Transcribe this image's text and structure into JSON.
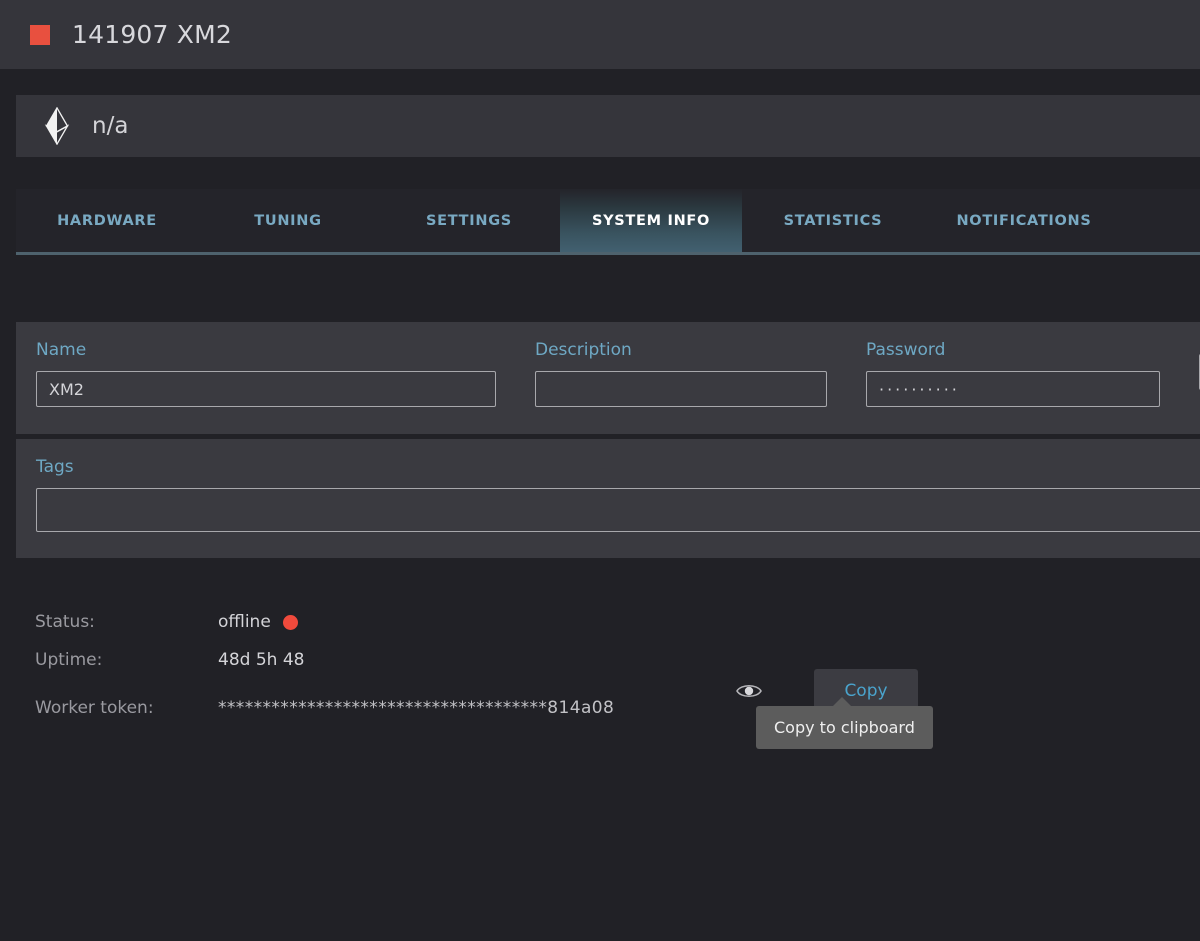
{
  "titlebar": {
    "swatch_color": "#e8503f",
    "title": "141907 XM2"
  },
  "coinbar": {
    "icon": "ethereum-icon",
    "label": "n/a"
  },
  "tabs": [
    {
      "label": "HARDWARE",
      "active": false
    },
    {
      "label": "TUNING",
      "active": false
    },
    {
      "label": "SETTINGS",
      "active": false
    },
    {
      "label": "SYSTEM INFO",
      "active": true
    },
    {
      "label": "STATISTICS",
      "active": false
    },
    {
      "label": "NOTIFICATIONS",
      "active": false
    }
  ],
  "form": {
    "name": {
      "label": "Name",
      "value": "XM2",
      "placeholder": ""
    },
    "description": {
      "label": "Description",
      "value": "",
      "placeholder": ""
    },
    "password": {
      "label": "Password",
      "value": "··········",
      "placeholder": ""
    },
    "extra": {
      "label": "",
      "value": "",
      "placeholder": ""
    },
    "tags": {
      "label": "Tags",
      "value": "",
      "placeholder": ""
    }
  },
  "status": {
    "status_label": "Status:",
    "status_value": "offline",
    "status_color": "#f04a3c",
    "uptime_label": "Uptime:",
    "uptime_value": "48d 5h 48",
    "token_label": "Worker token:",
    "token_value": "*************************************814a08",
    "eye_icon": "eye-icon",
    "copy_label": "Copy",
    "tooltip": "Copy to clipboard"
  }
}
